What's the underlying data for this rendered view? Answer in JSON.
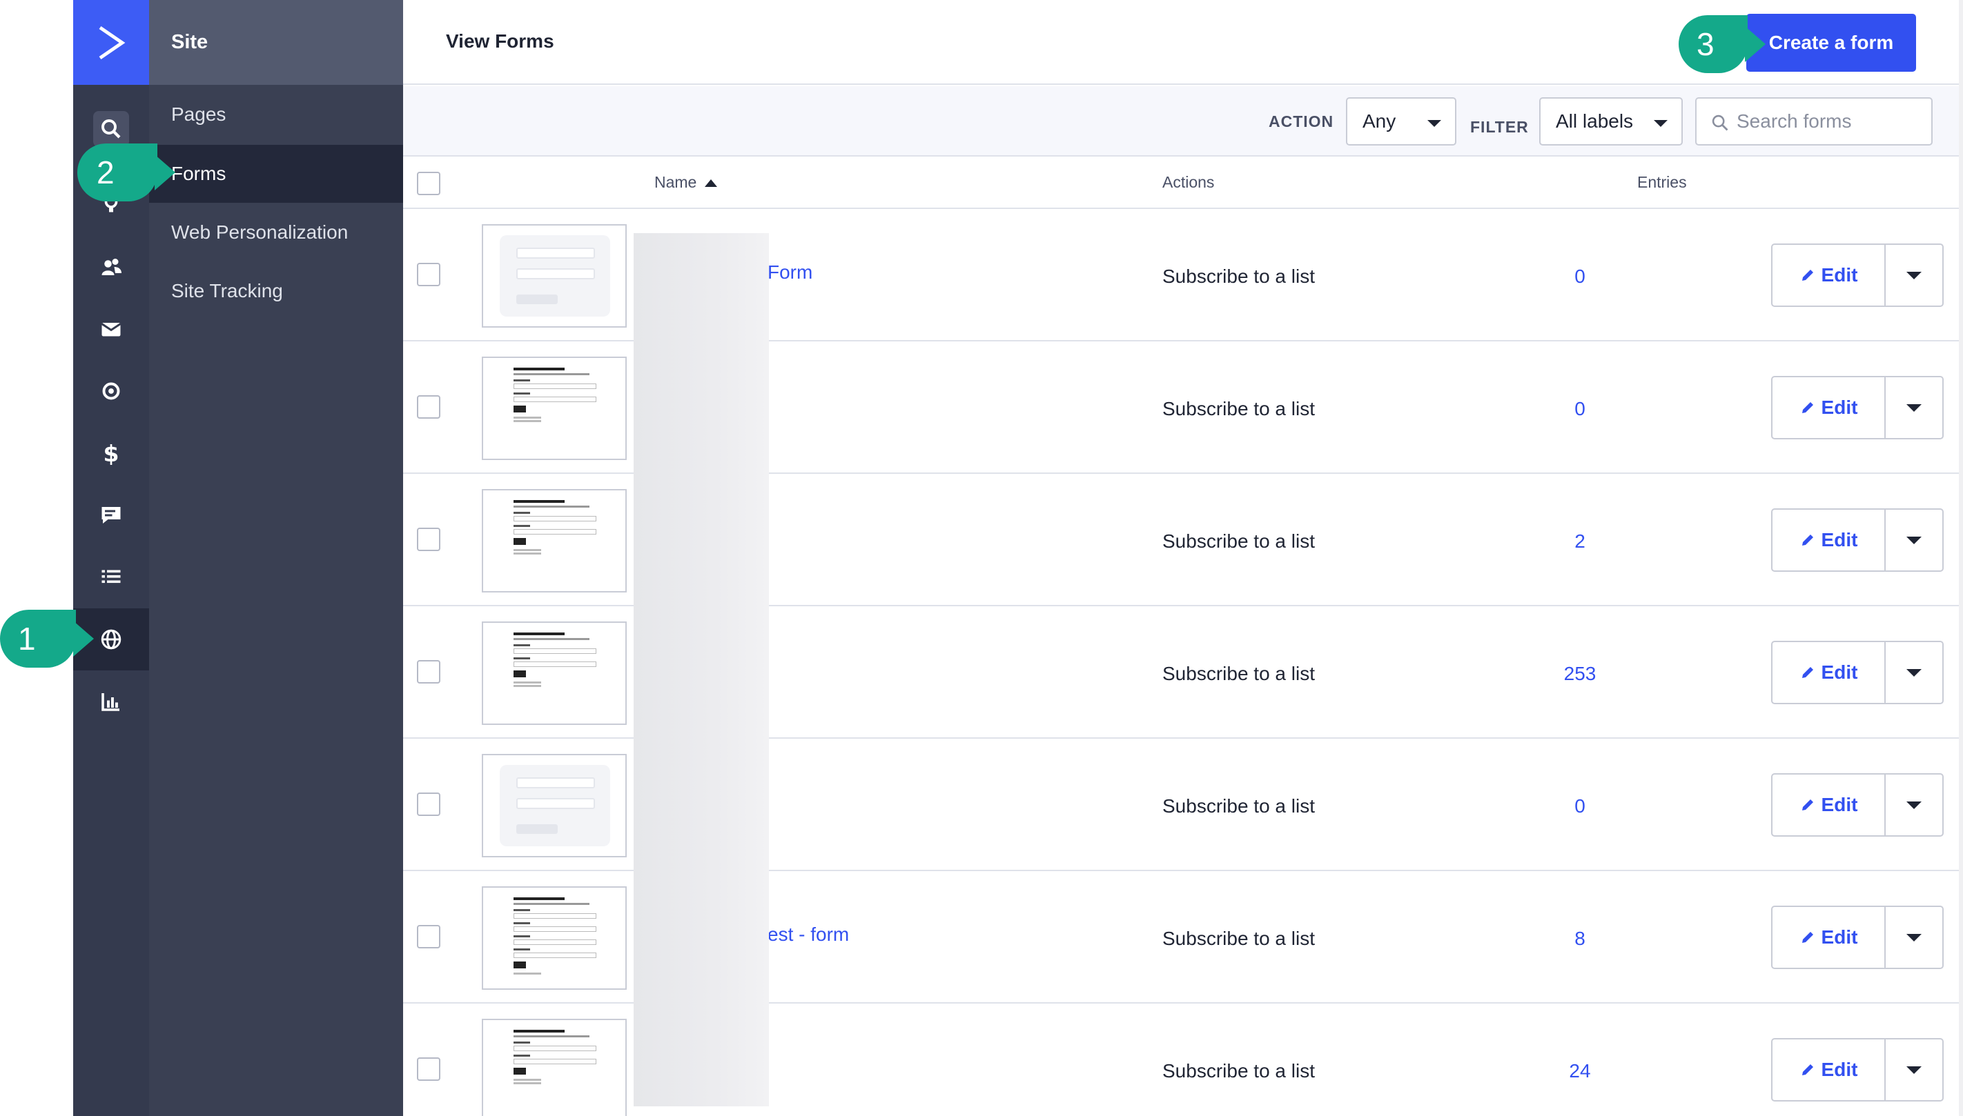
{
  "rail": {
    "items": [
      {
        "name": "search-icon"
      },
      {
        "name": "lightbulb-icon"
      },
      {
        "name": "contacts-icon"
      },
      {
        "name": "email-icon"
      },
      {
        "name": "automation-icon"
      },
      {
        "name": "deals-dollar-icon"
      },
      {
        "name": "conversations-icon"
      },
      {
        "name": "lists-icon"
      },
      {
        "name": "globe-icon"
      },
      {
        "name": "reports-icon"
      }
    ]
  },
  "subnav": {
    "title": "Site",
    "items": [
      {
        "label": "Pages"
      },
      {
        "label": "Forms"
      },
      {
        "label": "Web Personalization"
      },
      {
        "label": "Site Tracking"
      }
    ]
  },
  "header": {
    "title": "View Forms",
    "create_label": "Create a form"
  },
  "filters": {
    "action_label": "ACTION",
    "action_value": "Any",
    "filter_label": "FILTER",
    "filter_value": "All labels",
    "search_placeholder": "Search forms"
  },
  "table": {
    "columns": {
      "name": "Name",
      "actions": "Actions",
      "entries": "Entries"
    },
    "rows": [
      {
        "name": "Form",
        "action": "Subscribe to a list",
        "entries": "0",
        "edit": "Edit"
      },
      {
        "name": "",
        "action": "Subscribe to a list",
        "entries": "0",
        "edit": "Edit"
      },
      {
        "name": "",
        "action": "Subscribe to a list",
        "entries": "2",
        "edit": "Edit"
      },
      {
        "name": "",
        "action": "Subscribe to a list",
        "entries": "253",
        "edit": "Edit"
      },
      {
        "name": "",
        "action": "Subscribe to a list",
        "entries": "0",
        "edit": "Edit"
      },
      {
        "name": "est - form",
        "action": "Subscribe to a list",
        "entries": "8",
        "edit": "Edit"
      },
      {
        "name": "",
        "action": "Subscribe to a list",
        "entries": "24",
        "edit": "Edit"
      }
    ]
  },
  "callouts": {
    "one": "1",
    "two": "2",
    "three": "3"
  },
  "colors": {
    "accent": "#3250f0",
    "callout": "#14a98a",
    "rail": "#343a4e",
    "subnav": "#3a4053"
  }
}
